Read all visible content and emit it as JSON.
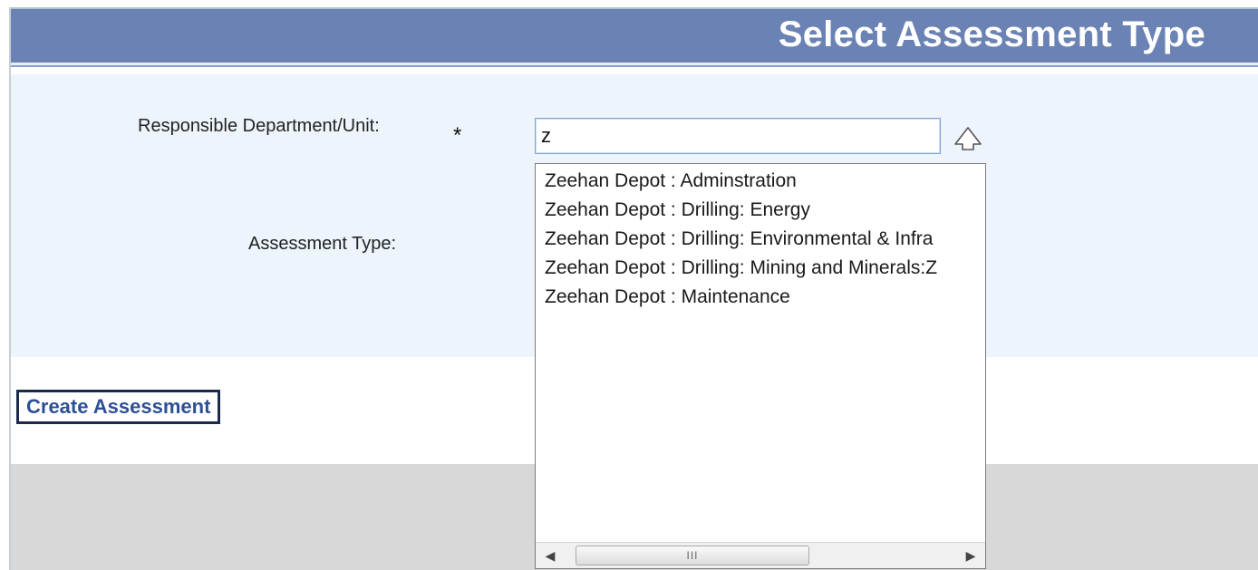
{
  "header": {
    "title": "Select Assessment Type"
  },
  "form": {
    "department_label": "Responsible Department/Unit:",
    "required_marker": "*",
    "department_value": "z",
    "assessment_type_label": "Assessment Type:"
  },
  "dropdown": {
    "items": [
      "Zeehan Depot : Adminstration",
      "Zeehan Depot : Drilling: Energy",
      "Zeehan Depot : Drilling: Environmental & Infra",
      "Zeehan Depot : Drilling: Mining and Minerals:Z",
      "Zeehan Depot : Maintenance"
    ],
    "scroll_grip": "III"
  },
  "actions": {
    "create_label": "Create Assessment"
  },
  "icons": {
    "toggle": "chevron-up-outline-icon",
    "scroll_left": "arrow-left-icon",
    "scroll_right": "arrow-right-icon"
  },
  "colors": {
    "header_bg": "#6a82b4",
    "form_bg": "#eef4fc",
    "button_text": "#2c4f96"
  }
}
